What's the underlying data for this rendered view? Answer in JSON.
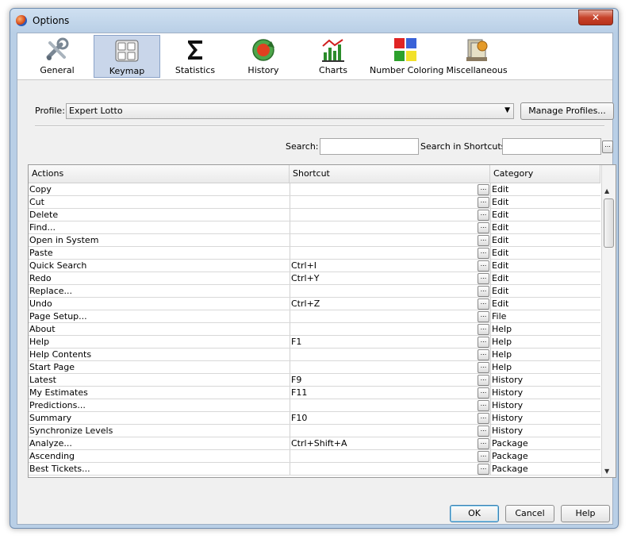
{
  "window": {
    "title": "Options",
    "close_label": "✕"
  },
  "toolbar": {
    "items": [
      {
        "label": "General",
        "icon": "tools-icon"
      },
      {
        "label": "Keymap",
        "icon": "keyboard-icon"
      },
      {
        "label": "Statistics",
        "icon": "sigma-icon"
      },
      {
        "label": "History",
        "icon": "history-icon"
      },
      {
        "label": "Charts",
        "icon": "chart-icon"
      },
      {
        "label": "Number Coloring",
        "icon": "color-grid-icon"
      },
      {
        "label": "Miscellaneous",
        "icon": "misc-icon"
      }
    ],
    "selected": "Keymap"
  },
  "profile": {
    "label": "Profile:",
    "value": "Expert Lotto",
    "manage_label": "Manage Profiles..."
  },
  "search": {
    "label": "Search:",
    "value": "",
    "shortcuts_label": "Search in Shortcuts:",
    "shortcuts_value": "",
    "more_label": "..."
  },
  "table": {
    "columns": [
      "Actions",
      "Shortcut",
      "Category"
    ],
    "edit_button_label": "...",
    "rows": [
      {
        "action": "Copy",
        "shortcut": "",
        "category": "Edit"
      },
      {
        "action": "Cut",
        "shortcut": "",
        "category": "Edit"
      },
      {
        "action": "Delete",
        "shortcut": "",
        "category": "Edit"
      },
      {
        "action": "Find...",
        "shortcut": "",
        "category": "Edit"
      },
      {
        "action": "Open in System",
        "shortcut": "",
        "category": "Edit"
      },
      {
        "action": "Paste",
        "shortcut": "",
        "category": "Edit"
      },
      {
        "action": "Quick Search",
        "shortcut": "Ctrl+I",
        "category": "Edit"
      },
      {
        "action": "Redo",
        "shortcut": "Ctrl+Y",
        "category": "Edit"
      },
      {
        "action": "Replace...",
        "shortcut": "",
        "category": "Edit"
      },
      {
        "action": "Undo",
        "shortcut": "Ctrl+Z",
        "category": "Edit"
      },
      {
        "action": "Page Setup...",
        "shortcut": "",
        "category": "File"
      },
      {
        "action": "About",
        "shortcut": "",
        "category": "Help"
      },
      {
        "action": "Help",
        "shortcut": "F1",
        "category": "Help"
      },
      {
        "action": "Help Contents",
        "shortcut": "",
        "category": "Help"
      },
      {
        "action": "Start Page",
        "shortcut": "",
        "category": "Help"
      },
      {
        "action": "Latest",
        "shortcut": "F9",
        "category": "History"
      },
      {
        "action": "My Estimates",
        "shortcut": "F11",
        "category": "History"
      },
      {
        "action": "Predictions...",
        "shortcut": "",
        "category": "History"
      },
      {
        "action": "Summary",
        "shortcut": "F10",
        "category": "History"
      },
      {
        "action": "Synchronize Levels",
        "shortcut": "",
        "category": "History"
      },
      {
        "action": "Analyze...",
        "shortcut": "Ctrl+Shift+A",
        "category": "Package"
      },
      {
        "action": "Ascending",
        "shortcut": "",
        "category": "Package"
      },
      {
        "action": "Best Tickets...",
        "shortcut": "",
        "category": "Package"
      }
    ]
  },
  "buttons": {
    "ok": "OK",
    "cancel": "Cancel",
    "help": "Help"
  }
}
